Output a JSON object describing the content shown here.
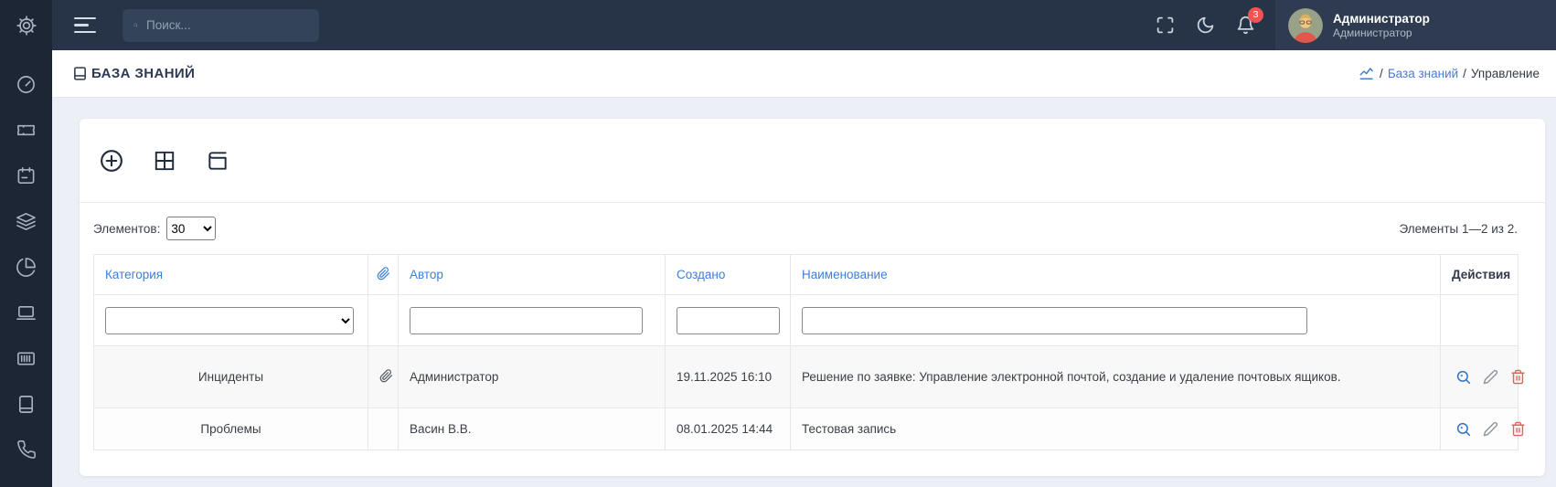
{
  "topbar": {
    "search_placeholder": "Поиск...",
    "notification_count": "3",
    "user_name": "Администратор",
    "user_role": "Администратор"
  },
  "header": {
    "title": "БАЗА ЗНАНИЙ",
    "breadcrumb": {
      "sep": "/",
      "link": "База знаний",
      "current": "Управление"
    }
  },
  "controls": {
    "per_page_label": "Элементов:",
    "per_page_value": "30",
    "summary": "Элементы 1—2 из 2."
  },
  "table": {
    "headers": {
      "category": "Категория",
      "author": "Автор",
      "created": "Создано",
      "name": "Наименование",
      "actions": "Действия"
    },
    "rows": [
      {
        "category": "Инциденты",
        "has_attachment": true,
        "author": "Администратор",
        "created": "19.11.2025 16:10",
        "name": "Решение по заявке: Управление электронной почтой, создание и удаление почтовых ящиков."
      },
      {
        "category": "Проблемы",
        "has_attachment": false,
        "author": "Васин В.В.",
        "created": "08.01.2025 14:44",
        "name": "Тестовая запись"
      }
    ]
  },
  "icons": {
    "sidebar": [
      "settings",
      "dashboard-gauge",
      "ticket",
      "calendar",
      "layers",
      "pie-chart",
      "laptop",
      "barcode",
      "book",
      "phone"
    ],
    "topbar": [
      "menu",
      "search",
      "fullscreen",
      "dark-mode-moon",
      "notifications-bell"
    ],
    "toolbar": [
      "add-plus-circle",
      "grid-view",
      "journal-book"
    ],
    "row_actions": [
      "view-magnifier",
      "edit-pencil",
      "delete-trash"
    ]
  },
  "colors": {
    "sidebar_bg": "#1d2634",
    "topbar_bg": "#273447",
    "accent_link": "#3e7edb",
    "badge_red": "#f15352",
    "page_bg": "#edeff6",
    "delete_red": "#e2625f",
    "view_blue": "#3272c3"
  }
}
